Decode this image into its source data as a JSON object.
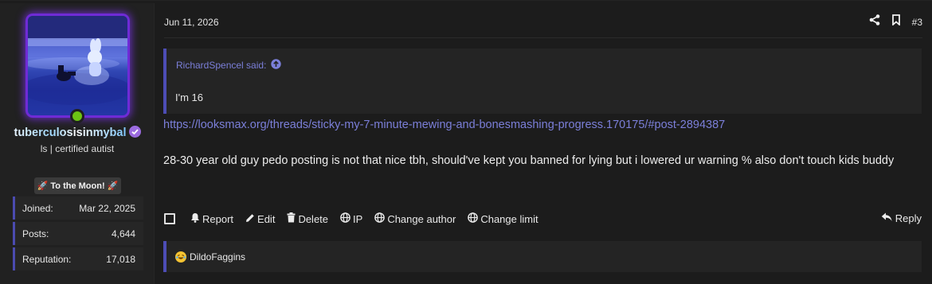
{
  "post": {
    "date": "Jun 11, 2026",
    "number": "#3",
    "quote": {
      "author_said": "RichardSpencel said:",
      "text": "I'm 16"
    },
    "link": "https://looksmax.org/threads/sticky-my-7-minute-mewing-and-bonesmashing-progress.170175/#post-2894387",
    "body": "28-30 year old guy pedo posting is not that nice tbh, should've kept you banned for lying but i lowered ur warning % also don't touch kids buddy",
    "actions": {
      "report": "Report",
      "edit": "Edit",
      "delete": "Delete",
      "ip": "IP",
      "change_author": "Change author",
      "change_limit": "Change limit",
      "reply": "Reply"
    },
    "reaction_user": "DildoFaggins"
  },
  "user": {
    "name": "tuberculosisinmybal",
    "title": "ls | certified autist",
    "banner": "To the Moon!",
    "online_color": "#6cc314",
    "stats": [
      {
        "label": "Joined:",
        "value": "Mar 22, 2025"
      },
      {
        "label": "Posts:",
        "value": "4,644"
      },
      {
        "label": "Reputation:",
        "value": "17,018"
      }
    ]
  },
  "colors": {
    "accent": "#4d4db5",
    "link": "#7b7fd9",
    "avatar_glow": "#6f2bd6"
  },
  "icons": [
    "share-icon",
    "bookmark-icon",
    "quote-up-arrow-icon",
    "bell-icon",
    "pencil-icon",
    "trash-icon",
    "globe-icon",
    "reply-icon",
    "rocket-icon",
    "verified-badge-icon",
    "laughing-emoji-icon"
  ]
}
